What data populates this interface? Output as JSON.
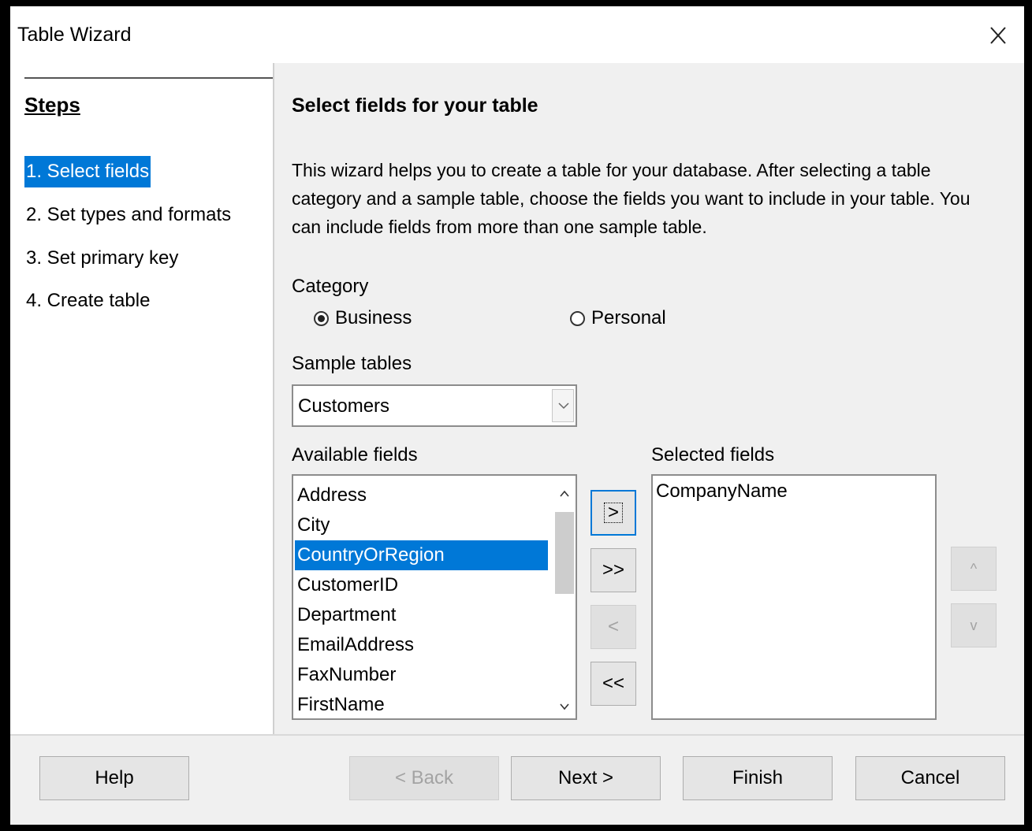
{
  "window": {
    "title": "Table Wizard",
    "close_icon": "close-icon"
  },
  "sidebar": {
    "heading": "Steps",
    "steps": [
      {
        "label": "1. Select fields",
        "active": true
      },
      {
        "label": "2. Set types and formats",
        "active": false
      },
      {
        "label": "3. Set primary key",
        "active": false
      },
      {
        "label": "4. Create table",
        "active": false
      }
    ]
  },
  "main": {
    "title": "Select fields for your table",
    "intro": "This wizard helps you to create a table for your database. After selecting a table category and a sample table, choose the fields you want to include in your table. You can include fields from more than one sample table.",
    "category": {
      "label": "Category",
      "options": [
        {
          "label": "Business",
          "checked": true
        },
        {
          "label": "Personal",
          "checked": false
        }
      ]
    },
    "sample_tables": {
      "label": "Sample tables",
      "value": "Customers"
    },
    "available_fields": {
      "label": "Available fields",
      "items": [
        "Address",
        "City",
        "CountryOrRegion",
        "CustomerID",
        "Department",
        "EmailAddress",
        "FaxNumber",
        "FirstName"
      ],
      "selected": "CountryOrRegion"
    },
    "move_buttons": [
      ">",
      ">>",
      "<",
      "<<"
    ],
    "selected_fields": {
      "label": "Selected fields",
      "items": [
        "CompanyName"
      ]
    },
    "order_buttons": [
      "^",
      "v"
    ]
  },
  "footer": {
    "help": "Help",
    "back": "< Back",
    "next": "Next >",
    "finish": "Finish",
    "cancel": "Cancel"
  },
  "colors": {
    "accent": "#0078d7",
    "dialog_bg": "#f0f0f0"
  }
}
